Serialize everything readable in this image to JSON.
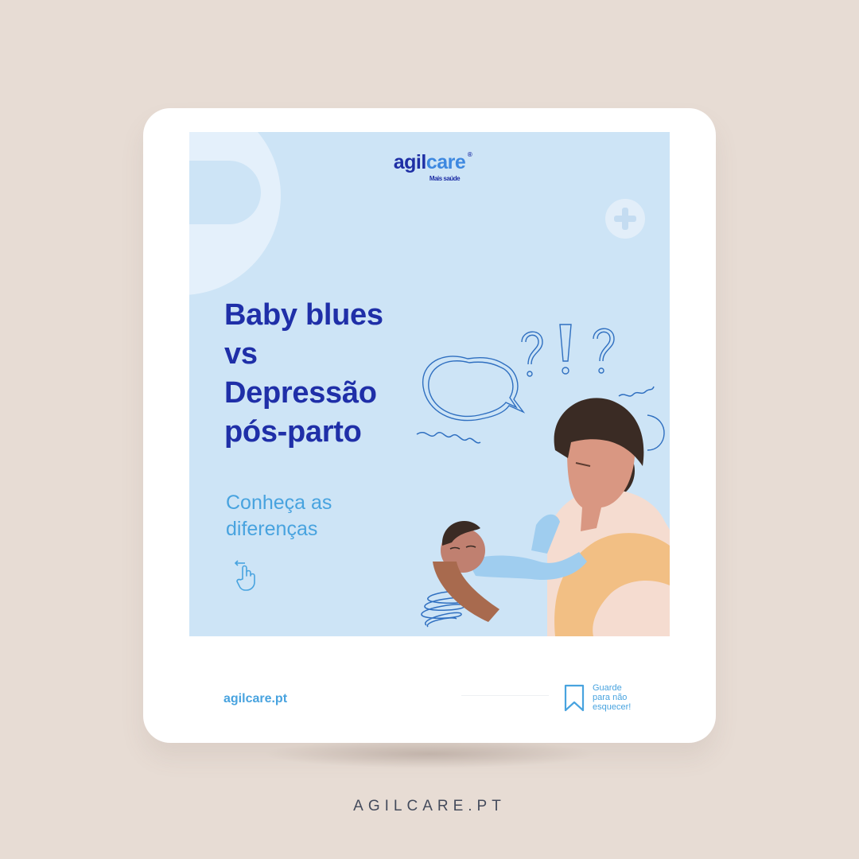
{
  "logo": {
    "part1": "agil",
    "part2": "care",
    "registered": "®",
    "tagline": "Mais saúde"
  },
  "slide": {
    "title_lines": [
      "Baby blues",
      "vs",
      "Depressão",
      "pós-parto"
    ],
    "subtitle_lines": [
      "Conheça as",
      "diferenças"
    ]
  },
  "card_footer": {
    "url": "agilcare.pt",
    "save_lines": [
      "Guarde",
      "para não",
      "esquecer!"
    ]
  },
  "brand": "AGILCARE.PT",
  "icons": [
    "plus-icon",
    "swipe-hand-icon",
    "bookmark-icon",
    "speech-bubble-icon",
    "question-mark-icon",
    "exclamation-mark-icon",
    "scribble-icon"
  ],
  "colors": {
    "page_bg": "#e7dcd4",
    "slide_bg": "#cde4f6",
    "primary": "#1f2fa8",
    "accent": "#48a3df",
    "doodle": "#2f6fc0"
  }
}
